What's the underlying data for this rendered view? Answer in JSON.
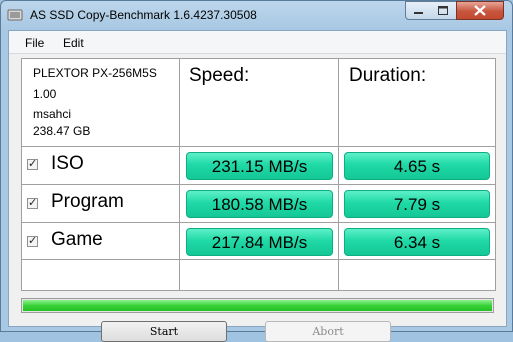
{
  "window": {
    "title": "AS SSD Copy-Benchmark 1.6.4237.30508"
  },
  "menu": {
    "items": [
      "File",
      "Edit"
    ]
  },
  "device": {
    "model": "PLEXTOR PX-256M5S",
    "firmware": "1.00",
    "driver": "msahci",
    "capacity": "238.47 GB"
  },
  "headers": {
    "speed": "Speed:",
    "duration": "Duration:"
  },
  "rows": [
    {
      "label": "ISO",
      "checked": true,
      "speed": "231.15 MB/s",
      "duration": "4.65 s"
    },
    {
      "label": "Program",
      "checked": true,
      "speed": "180.58 MB/s",
      "duration": "7.79 s"
    },
    {
      "label": "Game",
      "checked": true,
      "speed": "217.84 MB/s",
      "duration": "6.34 s"
    }
  ],
  "progress": {
    "value": 1.0,
    "color": "#22c022"
  },
  "buttons": {
    "start": "Start",
    "abort": "Abort"
  },
  "colors": {
    "result_fill": "#1fd9a6",
    "close_button": "#c7563f"
  }
}
